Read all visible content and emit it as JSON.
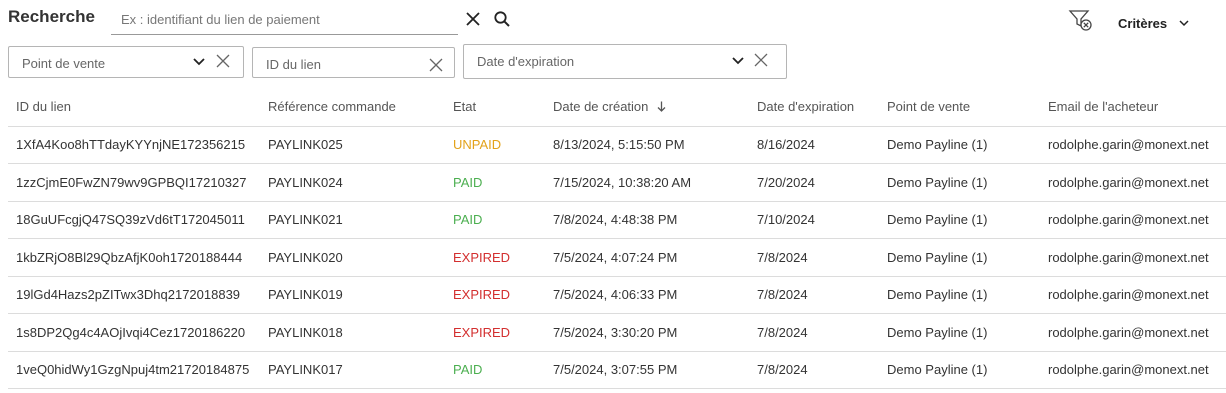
{
  "search": {
    "title": "Recherche",
    "placeholder": "Ex : identifiant du lien de paiement",
    "criteria_label": "Critères"
  },
  "filters": {
    "point_of_sale": "Point de vente",
    "link_id": "ID du lien",
    "expiration_date": "Date d'expiration"
  },
  "icons": {
    "clear": "close-icon",
    "search": "search-icon",
    "filter_clear": "filter-clear-icon",
    "dropdown": "chevron-down-icon",
    "sort": "arrow-down-icon"
  },
  "colors": {
    "unpaid": "#e3a21a",
    "paid": "#4caf50",
    "expired": "#d32f2f"
  },
  "table": {
    "headers": [
      "ID du lien",
      "Référence commande",
      "Etat",
      "Date de création",
      "Date d'expiration",
      "Point de vente",
      "Email de l'acheteur"
    ],
    "sorted_column": "Date de création",
    "sort_direction": "descending",
    "rows": [
      [
        "1XfA4Koo8hTTdayKYYnjNE172356215",
        "PAYLINK025",
        "UNPAID",
        "8/13/2024, 5:15:50 PM",
        "8/16/2024",
        "Demo Payline (1)",
        "rodolphe.garin@monext.net"
      ],
      [
        "1zzCjmE0FwZN79wv9GPBQI17210327",
        "PAYLINK024",
        "PAID",
        "7/15/2024, 10:38:20 AM",
        "7/20/2024",
        "Demo Payline (1)",
        "rodolphe.garin@monext.net"
      ],
      [
        "18GuUFcgjQ47SQ39zVd6tT172045011",
        "PAYLINK021",
        "PAID",
        "7/8/2024, 4:48:38 PM",
        "7/10/2024",
        "Demo Payline (1)",
        "rodolphe.garin@monext.net"
      ],
      [
        "1kbZRjO8Bl29QbzAfjK0oh1720188444",
        "PAYLINK020",
        "EXPIRED",
        "7/5/2024, 4:07:24 PM",
        "7/8/2024",
        "Demo Payline (1)",
        "rodolphe.garin@monext.net"
      ],
      [
        "19lGd4Hazs2pZITwx3Dhq2172018839",
        "PAYLINK019",
        "EXPIRED",
        "7/5/2024, 4:06:33 PM",
        "7/8/2024",
        "Demo Payline (1)",
        "rodolphe.garin@monext.net"
      ],
      [
        "1s8DP2Qg4c4AOjIvqi4Cez1720186220",
        "PAYLINK018",
        "EXPIRED",
        "7/5/2024, 3:30:20 PM",
        "7/8/2024",
        "Demo Payline (1)",
        "rodolphe.garin@monext.net"
      ],
      [
        "1veQ0hidWy1GzgNpuj4tm21720184875",
        "PAYLINK017",
        "PAID",
        "7/5/2024, 3:07:55 PM",
        "7/8/2024",
        "Demo Payline (1)",
        "rodolphe.garin@monext.net"
      ]
    ]
  }
}
